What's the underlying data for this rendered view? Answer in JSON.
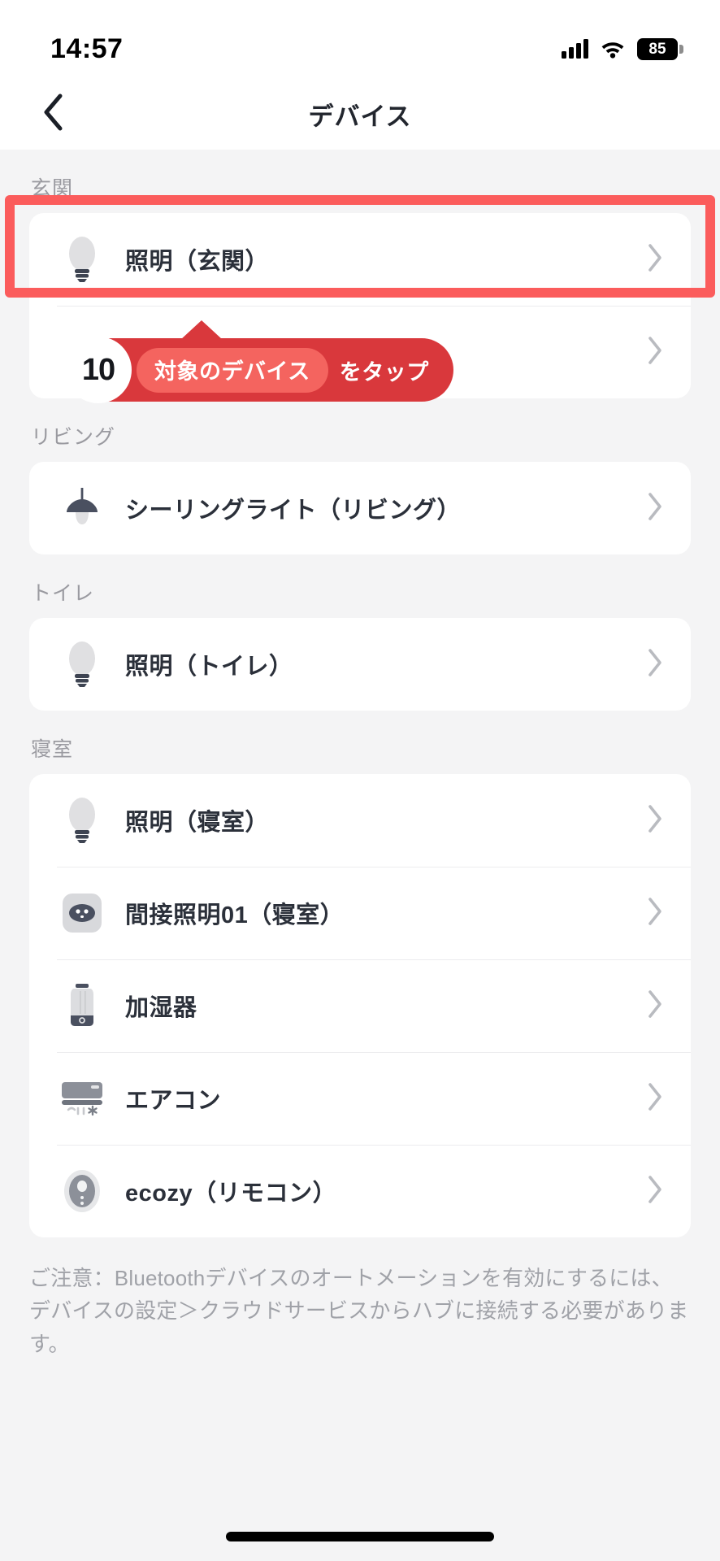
{
  "statusbar": {
    "time": "14:57",
    "battery": "85",
    "signal_icon": "cellular-signal-icon",
    "wifi_icon": "wifi-icon",
    "battery_icon": "battery-icon"
  },
  "navbar": {
    "back_icon": "chevron-left-icon",
    "title": "デバイス"
  },
  "sections": [
    {
      "title": "玄関",
      "rows": [
        {
          "label": "照明（玄関）",
          "icon": "lightbulb-icon",
          "chevron": "chevron-right-icon"
        },
        {
          "label": "",
          "icon": "lightbulb-icon",
          "chevron": "chevron-right-icon"
        }
      ]
    },
    {
      "title": "リビング",
      "rows": [
        {
          "label": "シーリングライト（リビング）",
          "icon": "ceiling-light-icon",
          "chevron": "chevron-right-icon"
        }
      ]
    },
    {
      "title": "トイレ",
      "rows": [
        {
          "label": "照明（トイレ）",
          "icon": "lightbulb-icon",
          "chevron": "chevron-right-icon"
        }
      ]
    },
    {
      "title": "寝室",
      "rows": [
        {
          "label": "照明（寝室）",
          "icon": "lightbulb-icon",
          "chevron": "chevron-right-icon"
        },
        {
          "label": "間接照明01（寝室）",
          "icon": "smart-plug-icon",
          "chevron": "chevron-right-icon"
        },
        {
          "label": "加湿器",
          "icon": "humidifier-icon",
          "chevron": "chevron-right-icon"
        },
        {
          "label": "エアコン",
          "icon": "air-conditioner-icon",
          "chevron": "chevron-right-icon"
        },
        {
          "label": "ecozy（リモコン）",
          "icon": "remote-sensor-icon",
          "chevron": "chevron-right-icon"
        }
      ]
    }
  ],
  "callout": {
    "step_number": "10",
    "pill_text": "対象のデバイス",
    "tail_text": "をタップ"
  },
  "footer": {
    "note": "ご注意：Bluetoothデバイスのオートメーションを有効にするには、デバイスの設定＞クラウドサービスからハブに接続する必要があります。"
  },
  "colors": {
    "highlight_border": "#fb5c5c",
    "callout_bg": "#d9383c",
    "callout_pill_bg": "#f4645f",
    "page_bg": "#f4f4f5",
    "card_bg": "#ffffff",
    "text_primary": "#2b303a",
    "text_muted": "#9a9aa0"
  }
}
